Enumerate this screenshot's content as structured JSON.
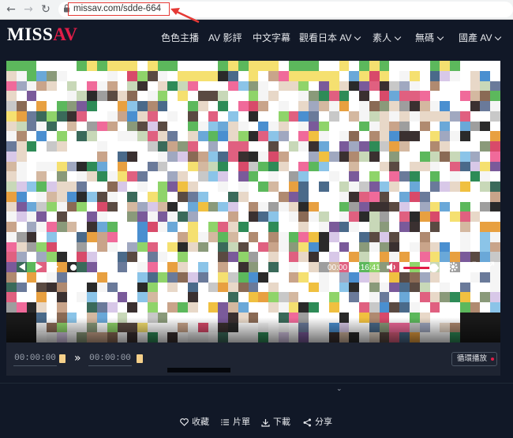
{
  "browser": {
    "url": "missav.com/sdde-664",
    "annotation_color": "#e53935"
  },
  "site": {
    "logo_a": "MISS",
    "logo_b": "AV",
    "accent": "#e11d48",
    "nav": [
      {
        "label": "色色主播",
        "dropdown": false
      },
      {
        "label": "AV 影評",
        "dropdown": false
      },
      {
        "label": "中文字幕",
        "dropdown": false
      },
      {
        "label": "觀看日本 AV",
        "dropdown": true
      },
      {
        "label": "素人",
        "dropdown": true
      },
      {
        "label": "無碼",
        "dropdown": true
      },
      {
        "label": "國產 AV",
        "dropdown": true
      }
    ]
  },
  "player": {
    "current_time": "00:00",
    "separator": "/",
    "duration": "2:16:41",
    "volume_fraction": 0.85,
    "state": "pixelated-preview"
  },
  "clip": {
    "start": "00:00:00",
    "end": "00:00:00",
    "loop_label": "循環播放"
  },
  "actions": [
    {
      "icon": "heart-icon",
      "label": "收藏"
    },
    {
      "icon": "list-icon",
      "label": "片單"
    },
    {
      "icon": "download-icon",
      "label": "下載"
    },
    {
      "icon": "share-icon",
      "label": "分享"
    }
  ]
}
